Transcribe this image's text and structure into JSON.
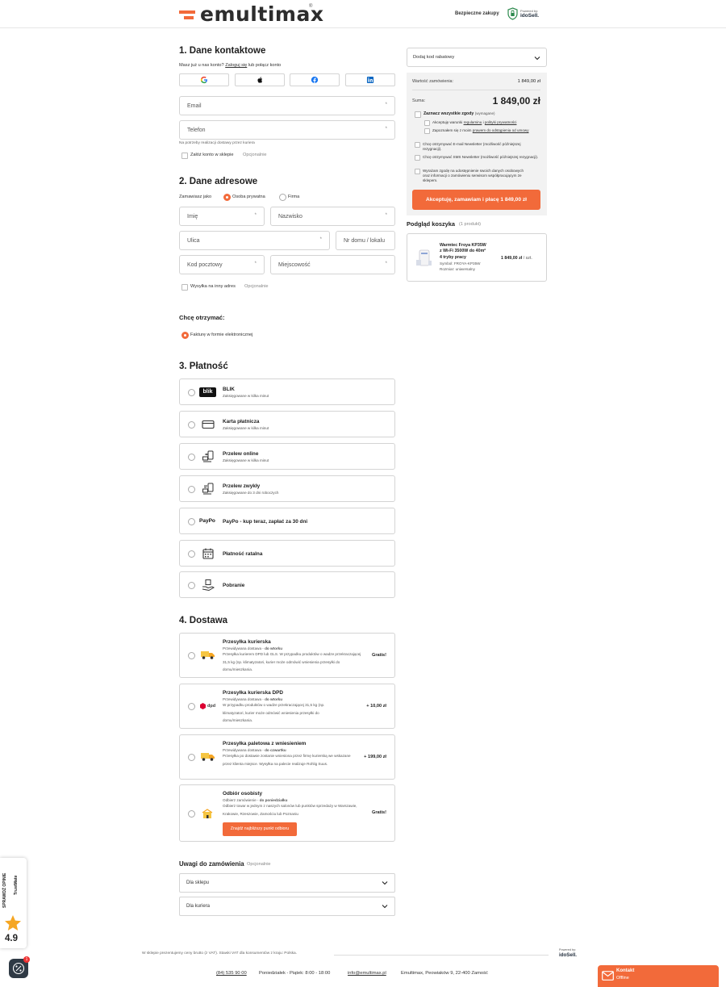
{
  "header": {
    "logo_text": "emultimax",
    "logo_reg": "®",
    "secure_label": "Bezpieczne zakupy",
    "powered_label": "Powered by:",
    "powered_brand": "idoSell."
  },
  "contact": {
    "title": "1. Dane kontaktowe",
    "have_account": "Masz już u nas konto?",
    "login_link": "Zaloguj się",
    "or_connect": "lub połącz konto",
    "email_label": "Email",
    "phone_label": "Telefon",
    "required_mark": "*",
    "phone_hint": "Na potrzeby realizacji dostawy przez kuriera",
    "create_account": "Załóż konto w sklepie",
    "optional": "Opcjonalnie"
  },
  "address": {
    "title": "2. Dane adresowe",
    "ordering_as": "Zamawiasz jako",
    "private_label": "Osoba prywatna",
    "company_label": "Firma",
    "first_name": "Imię",
    "last_name": "Nazwisko",
    "street": "Ulica",
    "house_no": "Nr domu / lokalu",
    "postal": "Kod pocztowy",
    "city": "Miejscowość",
    "ship_other": "Wysyłka na inny adres",
    "optional": "Opcjonalnie",
    "want_receive": "Chcę otrzymać:",
    "e_invoice": "Fakturę w formie elektronicznej"
  },
  "payment": {
    "title": "3. Płatność",
    "methods": [
      {
        "name": "BLIK",
        "sub": "Zaksięgowane w kilka minut",
        "icon": "blik-icon",
        "icon_text": "blik"
      },
      {
        "name": "Karta płatnicza",
        "sub": "Zaksięgowane w kilka minut",
        "icon": "card-icon"
      },
      {
        "name": "Przelew online",
        "sub": "Zaksięgowane w kilka minut",
        "icon": "transfer-icon"
      },
      {
        "name": "Przelew zwykły",
        "sub": "Zaksięgowane do 3 dni roboczych",
        "icon": "bank-transfer-icon"
      },
      {
        "name": "PayPo - kup teraz, zapłać za 30 dni",
        "sub": "",
        "icon": "paypo-icon",
        "icon_text": "PayPo"
      },
      {
        "name": "Płatność ratalna",
        "sub": "",
        "icon": "calendar-icon"
      },
      {
        "name": "Pobranie",
        "sub": "",
        "icon": "cash-on-delivery-icon"
      }
    ]
  },
  "delivery": {
    "title": "4. Dostawa",
    "options": [
      {
        "name": "Przesyłka kurierska",
        "eta_prefix": "Przewidywana dostawa - ",
        "eta": "do wtorku",
        "desc": "Przesyłka kurierem DPD lub GLS. W przypadku produktów o wadze przekraczającej 31,5 kg (np. klimatyzatori, kurier może odmówić wniesienia przesyłki do domu/mieszkania.",
        "price": "Gratis!"
      },
      {
        "name": "Przesyłka kurierska DPD",
        "eta_prefix": "Przewidywana dostawa - ",
        "eta": "do wtorku",
        "desc": "W przypadku produktów o wadze przekraczającej 31,5 kg (np. klimatyzatori, kurier może odmówić wniesienia przesyłki do domu/mieszkania.",
        "price": "+ 10,00 zł",
        "logo_text": "dpd"
      },
      {
        "name": "Przesyłka paletowa z wniesieniem",
        "eta_prefix": "Przewidywana dostawa - ",
        "eta": "do czwartku",
        "desc": "Przesyłka po dostawie zostanie wniesiona przez firmę kurierską we wskazane przez klienta miejsce. Wysyłka na palecie realizuje Rohlig Suus.",
        "price": "+ 199,00 zł"
      },
      {
        "name": "Odbiór osobisty",
        "eta_prefix": "Odbierz zamówienie - ",
        "eta": "do poniedziałku",
        "desc": "Odbierz towar w jednym z naszych salonów lub punktów sprzedaży w Warszawie, Krakowie, Rzeszowie, Zamościu lub Poznaniu",
        "price": "Gratis!",
        "button": "Znajdź najbliższy punkt odbioru"
      }
    ]
  },
  "notes": {
    "title": "Uwagi do zamówienia",
    "optional": "Opcjonalnie",
    "shop": "Dla sklepu",
    "courier": "Dla kuriera"
  },
  "summary": {
    "discount_label": "Dodaj kod rabatowy",
    "order_value_label": "Wartość zamówienia:",
    "order_value": "1 849,00 zł",
    "sum_label": "Suma:",
    "sum_value": "1 849,00 zł",
    "consent_all": "Zaznacz wszystkie zgody",
    "required": "(wymagane)",
    "consent_terms_a": "Akceptuję warunki ",
    "consent_terms_link1": "regulaminu",
    "consent_terms_b": " i ",
    "consent_terms_link2": "polityki prywatności",
    "consent_withdraw_a": "Zapoznałem się z moim ",
    "consent_withdraw_link": "prawem do odstąpienia od umowy",
    "consent_email": "Chcę otrzymywać E-mail Newsletter (możliwość późniejszej rezygnacji).",
    "consent_sms": "Chcę otrzymywać SMS Newsletter (możliwość późniejszej rezygnacji).",
    "consent_data": "Wyrażam zgodę na udostępnienie swoich danych osobowych oraz informacji o zamówieniu serwisom współpracującym ze sklepem.",
    "cta": "Akceptuję, zamawiam i płacę 1 849,00 zł",
    "cart_title": "Podgląd koszyka",
    "cart_count": "(1 produkt)",
    "product_name_1": "Warmtec Froya KP35W",
    "product_name_2": "z Wi-Fi 3500W do 40m²",
    "product_name_3": "4 tryby pracy",
    "product_symbol": "Symbol: FROYA-KP35W",
    "product_size": "Rozmiar: uniwersalny",
    "product_price": "1 849,00 zł",
    "product_unit": " / szt."
  },
  "footer": {
    "vat_note": "W sklepie prezentujemy ceny brutto (z VAT). Stawki VAT dla konsumentów z kraju: Polska.",
    "powered_label": "Powered by:",
    "powered_brand": "idoSell.",
    "phone": "(84) 535 90 00",
    "hours": "Poniedziałek - Piątek: 8:00 - 18:00",
    "email": "info@emultimax.pl",
    "address": "Emultimax, Peowiaków 9, 22-400 Zamość"
  },
  "widgets": {
    "trustmate_label": "SPRAWDŹ OPINIE",
    "trustmate_brand": "TrustMate",
    "rating": "4.9",
    "chat_badge": "1",
    "contact_title": "Kontakt",
    "contact_status": "Offline"
  },
  "colors": {
    "accent": "#f26a3a",
    "text": "#222222",
    "border": "#d4d4d4"
  }
}
